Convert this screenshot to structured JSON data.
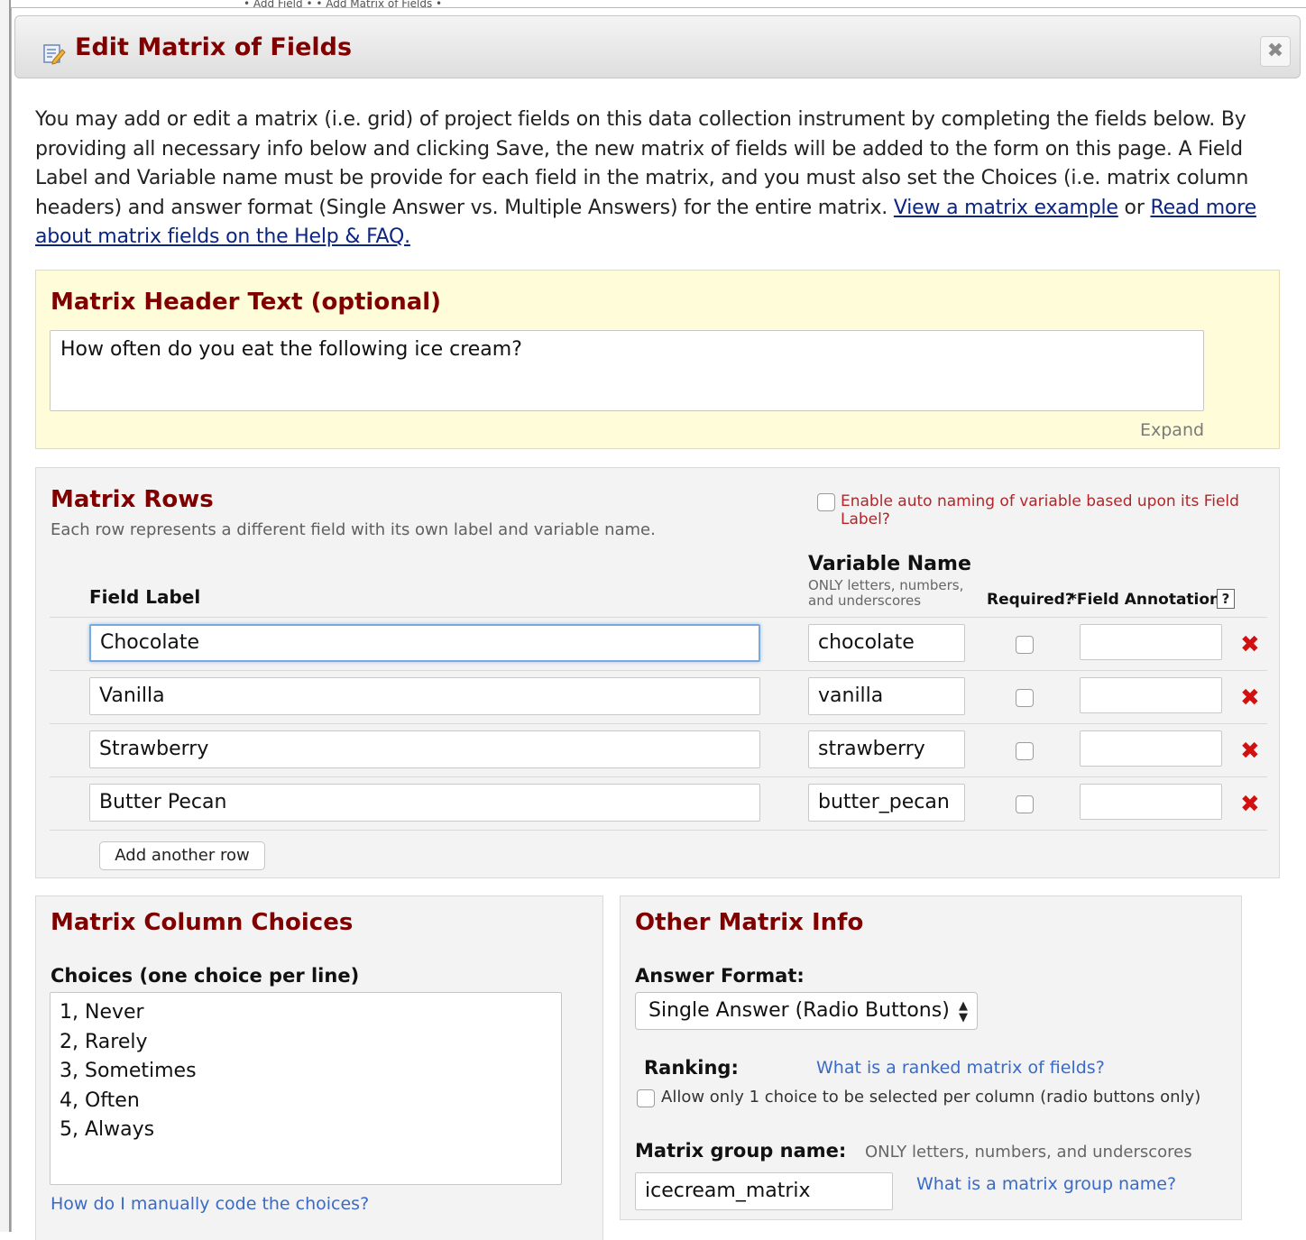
{
  "background_tabs": "• Add Field •  • Add Matrix of Fields •",
  "dialog": {
    "title": "Edit Matrix of Fields",
    "close_symbol": "✖"
  },
  "intro": {
    "text": "You may add or edit a matrix (i.e. grid) of project fields on this data collection instrument by completing the fields below. By providing all necessary info below and clicking Save, the new matrix of fields will be added to the form on this page. A Field Label and Variable name must be provide for each field in the matrix, and you must also set the Choices (i.e. matrix column headers) and answer format (Single Answer vs. Multiple Answers) for the entire matrix. ",
    "link1": "View a matrix example",
    "or": " or ",
    "link2": "Read more about matrix fields on the Help & FAQ."
  },
  "header_section": {
    "title": "Matrix Header Text (optional)",
    "value": "How often do you eat the following ice cream?",
    "expand": "Expand"
  },
  "rows_section": {
    "title": "Matrix Rows",
    "subtitle": "Each row represents a different field with its own label and variable name.",
    "auto_naming": "Enable auto naming of variable based upon its Field Label?",
    "col_field_label": "Field Label",
    "col_variable_name": "Variable Name",
    "col_variable_hint1": "ONLY letters, numbers,",
    "col_variable_hint2": "and underscores",
    "col_required": "Required?",
    "col_annotation": "*Field Annotation",
    "help_symbol": "?",
    "delete_symbol": "✖",
    "rows": [
      {
        "label": "Chocolate",
        "variable": "chocolate",
        "required": false,
        "annotation": ""
      },
      {
        "label": "Vanilla",
        "variable": "vanilla",
        "required": false,
        "annotation": ""
      },
      {
        "label": "Strawberry",
        "variable": "strawberry",
        "required": false,
        "annotation": ""
      },
      {
        "label": "Butter Pecan",
        "variable": "butter_pecan",
        "required": false,
        "annotation": ""
      }
    ],
    "add_row": "Add another row"
  },
  "choices_section": {
    "title": "Matrix Column Choices",
    "label": "Choices (one choice per line)",
    "choices": [
      "1, Never",
      "2, Rarely",
      "3, Sometimes",
      "4, Often",
      "5, Always"
    ],
    "help_link": "How do I manually code the choices?"
  },
  "other_section": {
    "title": "Other Matrix Info",
    "answer_format_label": "Answer Format:",
    "answer_format_value": "Single Answer (Radio Buttons)",
    "ranking_label": "Ranking:",
    "ranking_link": "What is a ranked matrix of fields?",
    "ranking_checkbox": "Allow only 1 choice to be selected per column (radio buttons only)",
    "group_name_label": "Matrix group name:",
    "group_name_hint": "ONLY letters, numbers, and underscores",
    "group_name_value": "icecream_matrix",
    "group_name_link": "What is a matrix group name?"
  },
  "colors": {
    "title_red": "#800000",
    "link_blue": "#3a6ac6",
    "header_panel_bg": "#fefcd9",
    "panel_bg": "#f3f3f3",
    "delete_red": "#d21010"
  }
}
